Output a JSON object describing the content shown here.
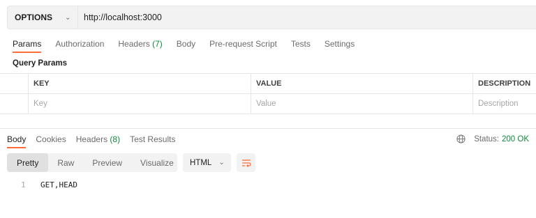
{
  "request": {
    "method": "OPTIONS",
    "url": "http://localhost:3000"
  },
  "request_tabs": [
    {
      "label": "Params",
      "count": ""
    },
    {
      "label": "Authorization",
      "count": ""
    },
    {
      "label": "Headers",
      "count": "(7)"
    },
    {
      "label": "Body",
      "count": ""
    },
    {
      "label": "Pre-request Script",
      "count": ""
    },
    {
      "label": "Tests",
      "count": ""
    },
    {
      "label": "Settings",
      "count": ""
    }
  ],
  "query_params": {
    "title": "Query Params",
    "headers": {
      "key": "KEY",
      "value": "VALUE",
      "description": "DESCRIPTION"
    },
    "placeholders": {
      "key": "Key",
      "value": "Value",
      "description": "Description"
    }
  },
  "response_tabs": [
    {
      "label": "Body",
      "count": ""
    },
    {
      "label": "Cookies",
      "count": ""
    },
    {
      "label": "Headers",
      "count": "(8)"
    },
    {
      "label": "Test Results",
      "count": ""
    }
  ],
  "status": {
    "label": "Status:",
    "value": "200 OK"
  },
  "view_modes": [
    "Pretty",
    "Raw",
    "Preview",
    "Visualize"
  ],
  "language": "HTML",
  "code_lines": [
    {
      "number": "1",
      "text": "GET,HEAD"
    }
  ],
  "colors": {
    "accent": "#ff6c37",
    "success": "#0d8a3a"
  }
}
